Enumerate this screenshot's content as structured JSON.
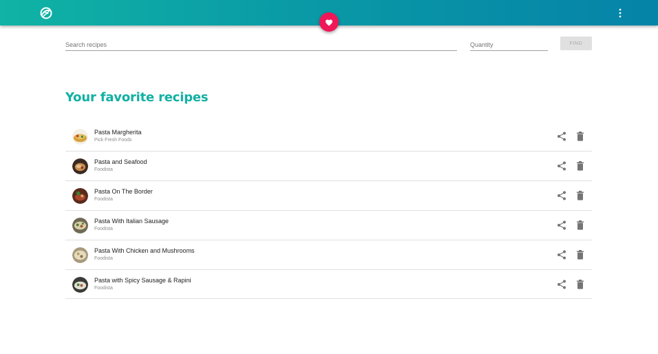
{
  "header": {
    "logo_icon": "swirl-logo-icon",
    "menu_icon": "more-vert-icon",
    "favorites_icon": "heart-icon",
    "accent_color": "#ef1758",
    "gradient_colors": [
      "#10b3a5",
      "#0583a8"
    ]
  },
  "search": {
    "recipes_placeholder": "Search recipes",
    "quantity_placeholder": "Quantity",
    "find_label": "FIND"
  },
  "main": {
    "title": "Your favorite recipes",
    "title_color": "#12b0a3",
    "recipes": [
      {
        "name": "Pasta Margherita",
        "source": "Pick Fresh Foods"
      },
      {
        "name": "Pasta and Seafood",
        "source": "Foodista"
      },
      {
        "name": "Pasta On The Border",
        "source": "Foodista"
      },
      {
        "name": "Pasta With Italian Sausage",
        "source": "Foodista"
      },
      {
        "name": "Pasta With Chicken and Mushrooms",
        "source": "Foodista"
      },
      {
        "name": "Pasta with Spicy Sausage & Rapini",
        "source": "Foodista"
      }
    ]
  }
}
